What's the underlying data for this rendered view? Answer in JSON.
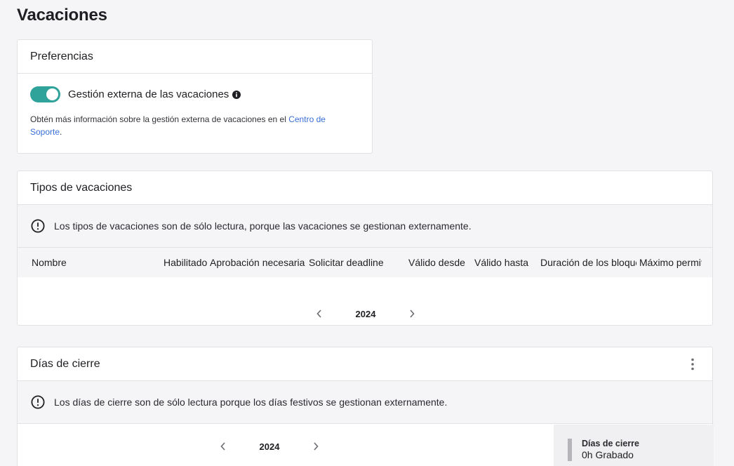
{
  "page": {
    "title": "Vacaciones"
  },
  "preferences": {
    "title": "Preferencias",
    "toggle_label": "Gestión externa de las vacaciones",
    "toggle_on": true,
    "help_text": "Obtén más información sobre la gestión externa de vacaciones en el ",
    "help_link": "Centro de Soporte",
    "help_end": "."
  },
  "types": {
    "title": "Tipos de vacaciones",
    "notice": "Los tipos de vacaciones son de sólo lectura, porque las vacaciones se gestionan externamente.",
    "columns": [
      "Nombre",
      "Habilitado",
      "Aprobación necesaria",
      "Solicitar deadline",
      "Válido desde",
      "Válido hasta",
      "Duración de los bloques",
      "Máximo permitido"
    ],
    "year": "2024"
  },
  "closure": {
    "title": "Días de cierre",
    "notice": "Los días de cierre son de sólo lectura porque los días festivos se gestionan externamente.",
    "year": "2024",
    "legend_title": "Días de cierre",
    "legend_value": "0h Grabado"
  },
  "colors": {
    "accent": "#2fa39a",
    "link": "#3a6fd8",
    "background": "#f5f5f7"
  },
  "icons": [
    "info-icon",
    "alert-circle-icon",
    "chevron-left-icon",
    "chevron-right-icon",
    "kebab-menu-icon"
  ]
}
